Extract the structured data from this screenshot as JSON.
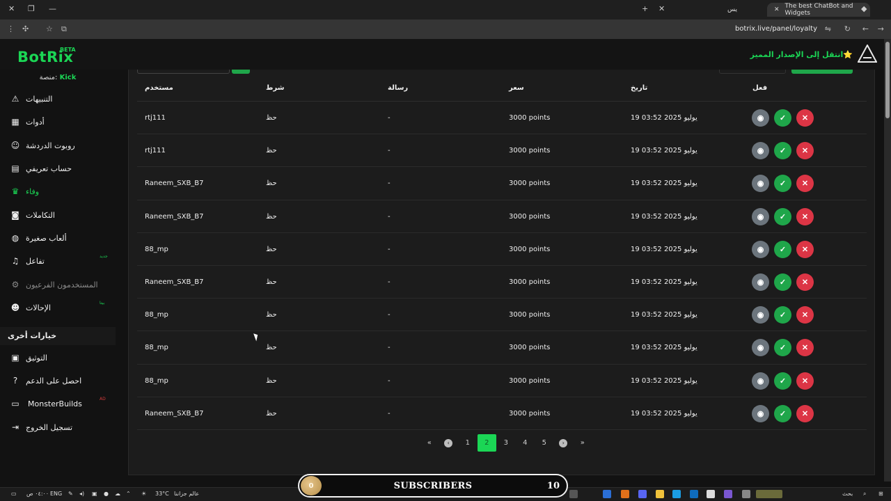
{
  "browser": {
    "active_tab_title": "The best ChatBot and Widgets",
    "other_tab_title": "يس",
    "url": "botrix.live/panel/loyalty"
  },
  "header": {
    "logo": "BotRix",
    "logo_badge": "BETA",
    "premium_link": "انتقل إلى الإصدار المميز⭐"
  },
  "sidebar": {
    "platform_label": "منصة:",
    "platform_value": "Kick",
    "items": [
      {
        "label": "التنبيهات",
        "icon": "⚠"
      },
      {
        "label": "أدوات",
        "icon": "▦"
      },
      {
        "label": "روبوت الدردشة",
        "icon": "☺"
      },
      {
        "label": "حساب تعريفي",
        "icon": "▤"
      },
      {
        "label": "وفاء",
        "icon": "♛"
      },
      {
        "label": "التكاملات",
        "icon": "◙"
      },
      {
        "label": "ألعاب صغيرة",
        "icon": "◍"
      },
      {
        "label": "تفاعل",
        "icon": "♫",
        "badge": "جديد"
      },
      {
        "label": "المستخدمون الفرعيون",
        "icon": "⚙"
      },
      {
        "label": "الإحالات",
        "icon": "☻",
        "badge": "بيتا"
      }
    ],
    "section_title": "خيارات أخرى",
    "other_items": [
      {
        "label": "التوثيق",
        "icon": "▣"
      },
      {
        "label": "احصل على الدعم",
        "icon": "?"
      },
      {
        "label": "MonsterBuilds",
        "icon": "▭",
        "badge": "AD"
      },
      {
        "label": "تسجيل الخروج",
        "icon": "⇥"
      }
    ]
  },
  "table": {
    "columns": {
      "user": "مستخدم",
      "condition": "شرط",
      "message": "رسالة",
      "price": "سعر",
      "date": "تاريخ",
      "action": "فعل"
    },
    "rows": [
      {
        "user": "rtj111",
        "condition": "حظ",
        "message": "-",
        "price": "3000 points",
        "date": "يوليو 2025 03:52 19"
      },
      {
        "user": "rtj111",
        "condition": "حظ",
        "message": "-",
        "price": "3000 points",
        "date": "يوليو 2025 03:52 19"
      },
      {
        "user": "Raneem_SXB_B7",
        "condition": "حظ",
        "message": "-",
        "price": "3000 points",
        "date": "يوليو 2025 03:52 19"
      },
      {
        "user": "Raneem_SXB_B7",
        "condition": "حظ",
        "message": "-",
        "price": "3000 points",
        "date": "يوليو 2025 03:52 19"
      },
      {
        "user": "88_mp",
        "condition": "حظ",
        "message": "-",
        "price": "3000 points",
        "date": "يوليو 2025 03:52 19"
      },
      {
        "user": "Raneem_SXB_B7",
        "condition": "حظ",
        "message": "-",
        "price": "3000 points",
        "date": "يوليو 2025 03:52 19"
      },
      {
        "user": "88_mp",
        "condition": "حظ",
        "message": "-",
        "price": "3000 points",
        "date": "يوليو 2025 03:52 19"
      },
      {
        "user": "88_mp",
        "condition": "حظ",
        "message": "-",
        "price": "3000 points",
        "date": "يوليو 2025 03:52 19"
      },
      {
        "user": "88_mp",
        "condition": "حظ",
        "message": "-",
        "price": "3000 points",
        "date": "يوليو 2025 03:52 19"
      },
      {
        "user": "Raneem_SXB_B7",
        "condition": "حظ",
        "message": "-",
        "price": "3000 points",
        "date": "يوليو 2025 03:52 19"
      }
    ]
  },
  "pagination": {
    "first": "«",
    "prev": "‹",
    "pages": [
      "1",
      "2",
      "3",
      "4",
      "5"
    ],
    "current": "2",
    "next": "›",
    "last": "»"
  },
  "taskbar": {
    "time": "٠٤:٠٠ ص",
    "lang": "ENG",
    "weather": "33°C",
    "weather_label": "عالم جزاننا",
    "search": "بحث"
  },
  "overlay": {
    "subscribers_label": "SUBSCRIBERS",
    "coin_value": "0",
    "count": "10"
  },
  "colors": {
    "brand": "#1bd655",
    "view_button": "#6c757d",
    "approve_button": "#1fa64a",
    "reject_button": "#dc3545"
  }
}
